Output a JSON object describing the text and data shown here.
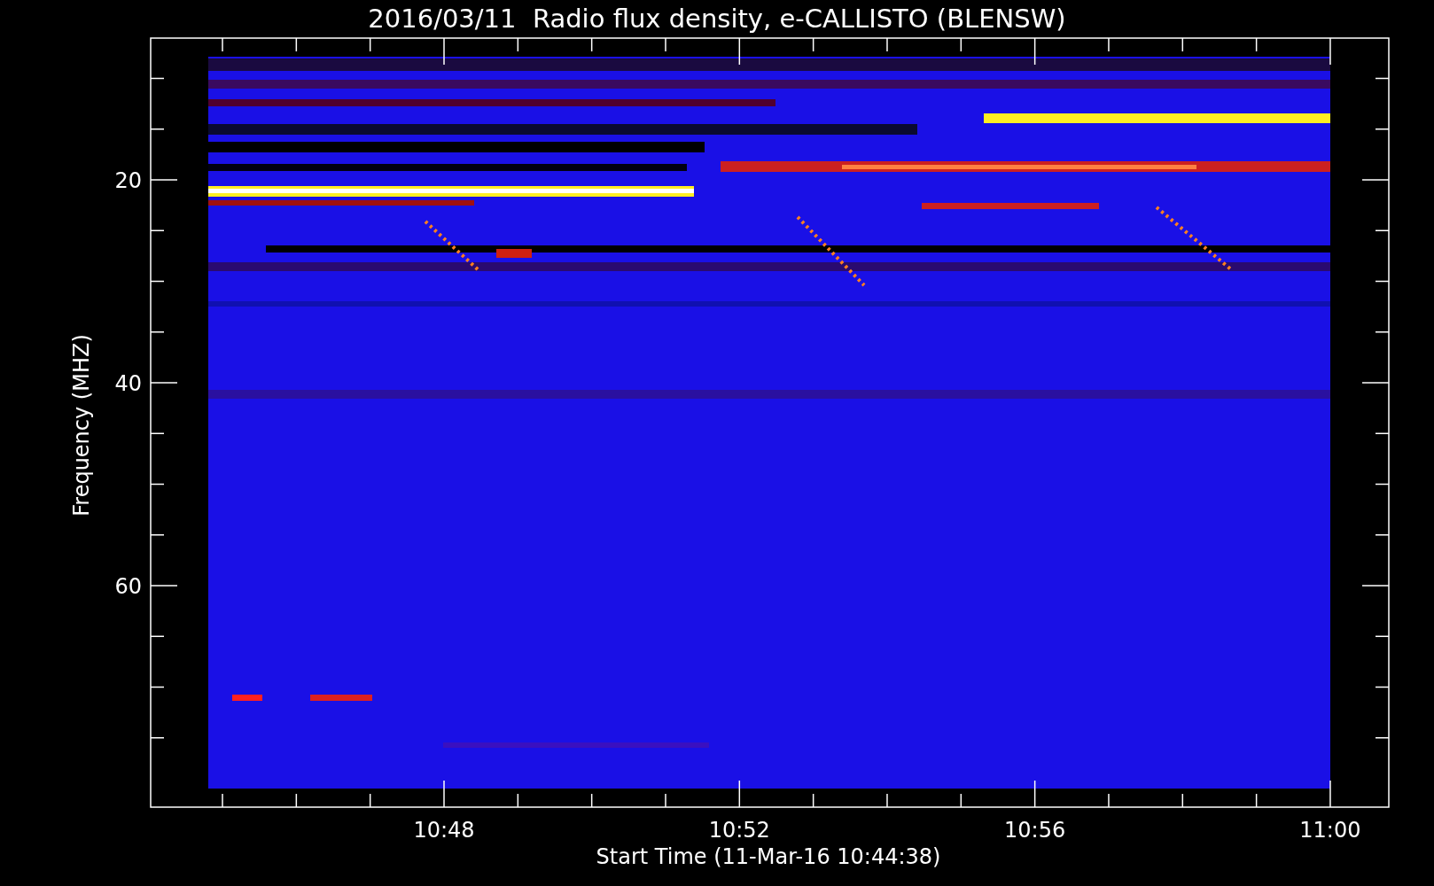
{
  "title": "2016/03/11  Radio flux density, e-CALLISTO (BLENSW)",
  "chart": {
    "kind": "spectrogram",
    "ylabel": "Frequency (MHZ)",
    "xlabel": "Start Time (11-Mar-16 10:44:38)",
    "yticks": [
      "20",
      "40",
      "60"
    ],
    "xticks": [
      "10:48",
      "10:52",
      "10:56",
      "11:00"
    ]
  }
}
